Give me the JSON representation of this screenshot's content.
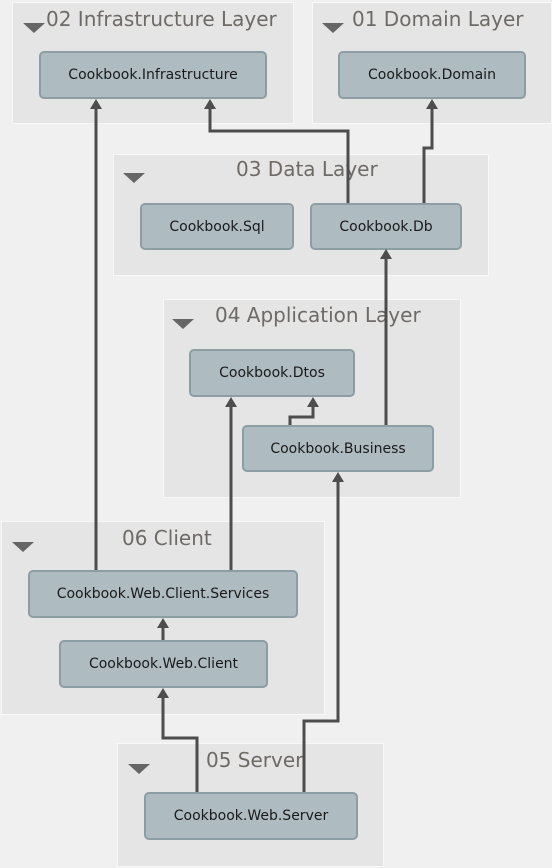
{
  "groups": {
    "infrastructure": {
      "title": "02 Infrastructure Layer"
    },
    "domain": {
      "title": "01 Domain Layer"
    },
    "data": {
      "title": "03 Data Layer"
    },
    "application": {
      "title": "04 Application Layer"
    },
    "client": {
      "title": "06 Client"
    },
    "server": {
      "title": "05 Server"
    }
  },
  "nodes": {
    "infrastructure": "Cookbook.Infrastructure",
    "domain": "Cookbook.Domain",
    "sql": "Cookbook.Sql",
    "db": "Cookbook.Db",
    "dtos": "Cookbook.Dtos",
    "business": "Cookbook.Business",
    "client_services": "Cookbook.Web.Client.Services",
    "web_client": "Cookbook.Web.Client",
    "web_server": "Cookbook.Web.Server"
  },
  "edges": [
    {
      "from": "Cookbook.Db",
      "to": "Cookbook.Infrastructure"
    },
    {
      "from": "Cookbook.Db",
      "to": "Cookbook.Domain"
    },
    {
      "from": "Cookbook.Business",
      "to": "Cookbook.Db"
    },
    {
      "from": "Cookbook.Business",
      "to": "Cookbook.Dtos"
    },
    {
      "from": "Cookbook.Web.Client.Services",
      "to": "Cookbook.Infrastructure"
    },
    {
      "from": "Cookbook.Web.Client.Services",
      "to": "Cookbook.Dtos"
    },
    {
      "from": "Cookbook.Web.Client",
      "to": "Cookbook.Web.Client.Services"
    },
    {
      "from": "Cookbook.Web.Server",
      "to": "Cookbook.Web.Client"
    },
    {
      "from": "Cookbook.Web.Server",
      "to": "Cookbook.Business"
    }
  ],
  "colors": {
    "group_background": "#e5e5e5",
    "node_fill": "#aebcc1",
    "node_border": "#8d9da4",
    "edge": "#4d4d4d",
    "group_title": "#6e6a66"
  }
}
